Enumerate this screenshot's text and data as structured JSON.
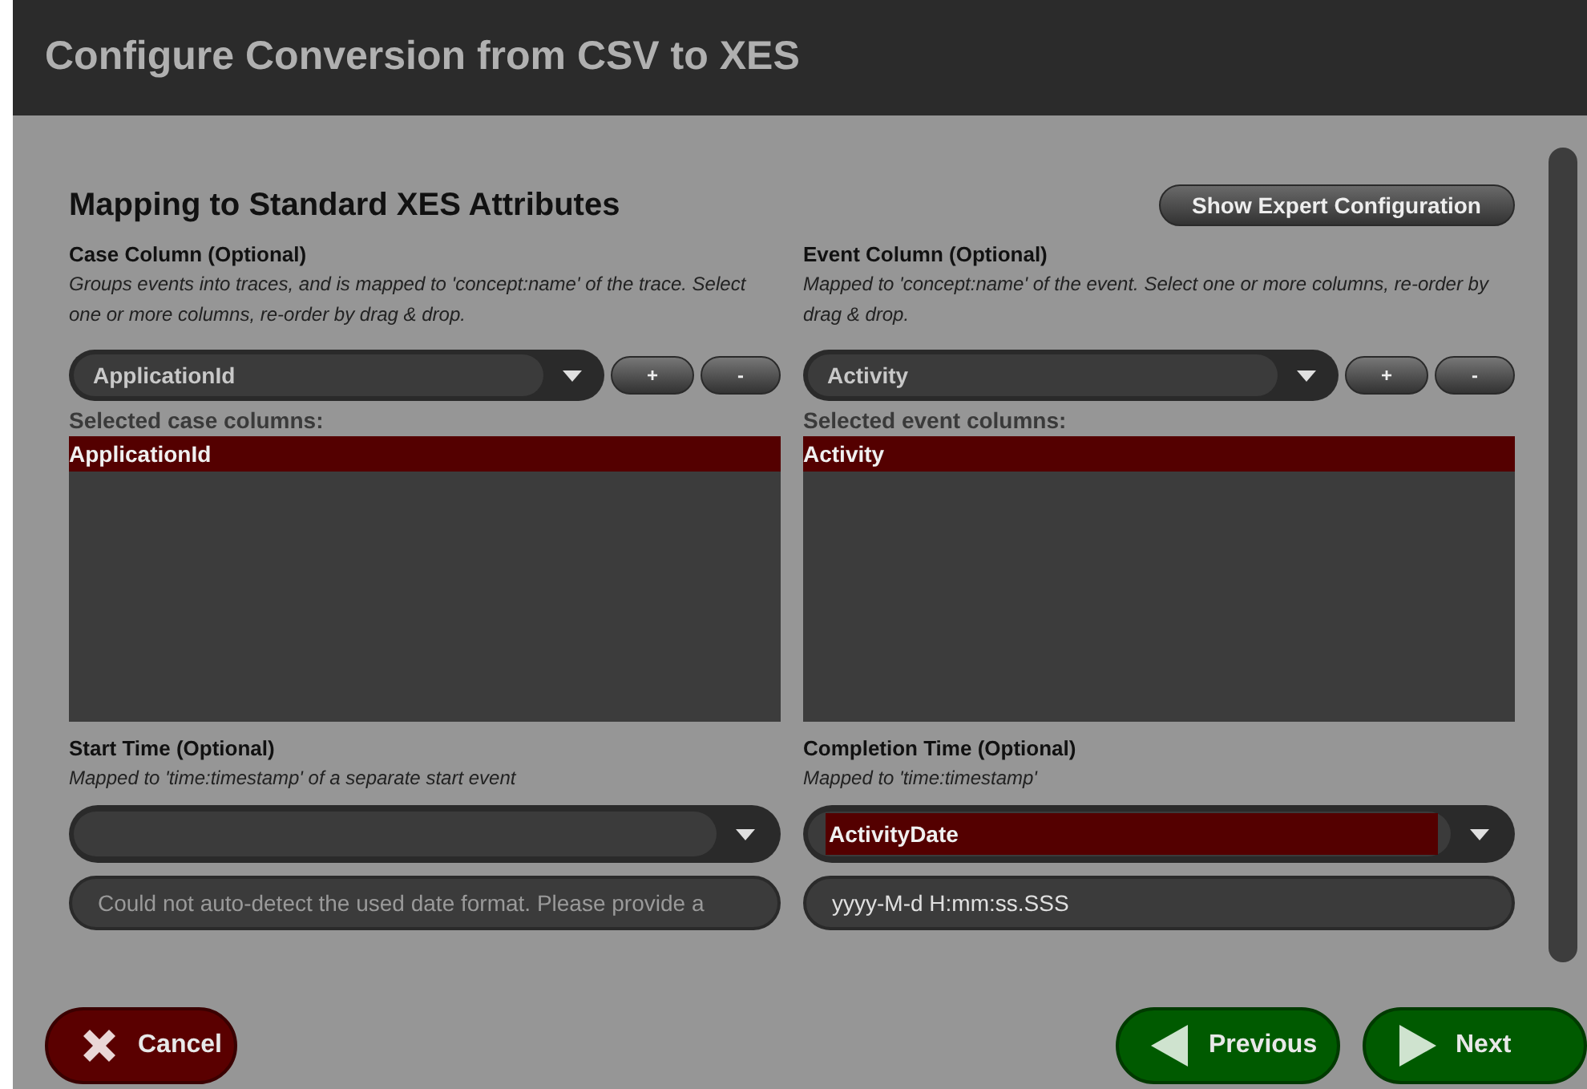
{
  "window": {
    "title": "Configure Conversion from CSV to XES"
  },
  "section": {
    "title": "Mapping to Standard XES Attributes",
    "expert_button": "Show Expert Configuration"
  },
  "column_pickers": [
    {
      "label": "Case Column (Optional)",
      "description": "Groups events into traces, and is mapped to 'concept:name' of the trace. Select one or more columns, re-order by drag & drop.",
      "value": "ApplicationId",
      "add": "+",
      "remove": "-",
      "list_label": "Selected case columns:",
      "items": [
        {
          "text": "ApplicationId",
          "selected": true
        }
      ]
    },
    {
      "label": "Event Column (Optional)",
      "description": "Mapped to 'concept:name' of the event. Select one or more columns, re-order by drag & drop.",
      "value": "Activity",
      "add": "+",
      "remove": "-",
      "list_label": "Selected event columns:",
      "items": [
        {
          "text": "Activity",
          "selected": true
        }
      ]
    }
  ],
  "time_pickers": [
    {
      "label": "Start Time (Optional)",
      "description": "Mapped to 'time:timestamp' of a separate start event",
      "format": {
        "placeholder": "Could not auto-detect the used date format. Please provide a"
      }
    },
    {
      "label": "Completion Time (Optional)",
      "description": "Mapped to 'time:timestamp'",
      "value": "ActivityDate",
      "highlighted": true,
      "format": {
        "value": "yyyy-M-d H:mm:ss.SSS"
      }
    }
  ],
  "buttons": [
    {
      "kind": "cancel",
      "label": "Cancel"
    },
    {
      "kind": "previous",
      "label": "Previous"
    },
    {
      "kind": "next",
      "label": "Next"
    }
  ]
}
